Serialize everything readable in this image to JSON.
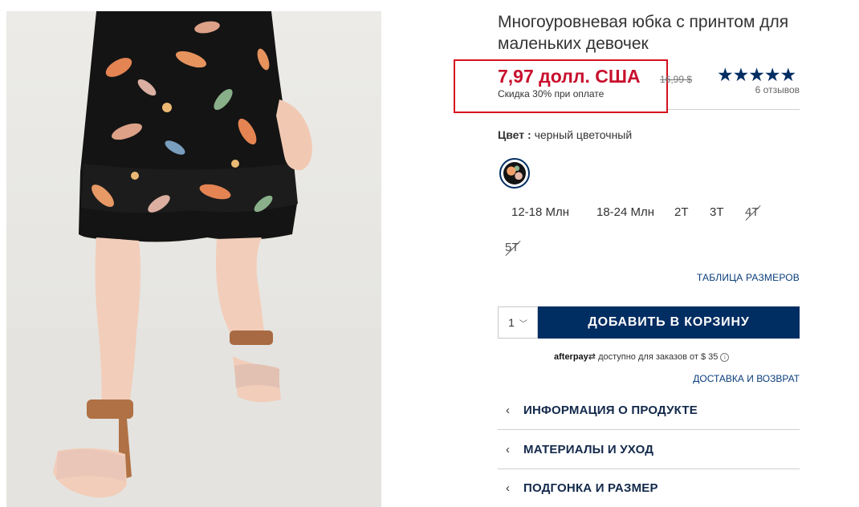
{
  "product": {
    "title": "Многоуровневая юбка с принтом для маленьких девочек",
    "price": "7,97 долл. США",
    "old_price": "16,99 $",
    "discount_note": "Скидка 30% при оплате",
    "rating_stars": "★★★★★",
    "rating_value": 4.5,
    "reviews": "6 отзывов"
  },
  "color": {
    "label": "Цвет :",
    "value": "черный цветочный",
    "swatch_icon": "floral-print-swatch"
  },
  "sizes": [
    {
      "label": "12-18 Млн",
      "available": true
    },
    {
      "label": "18-24 Млн",
      "available": true
    },
    {
      "label": "2T",
      "available": true
    },
    {
      "label": "3T",
      "available": true
    },
    {
      "label": "4T",
      "available": false
    },
    {
      "label": "5T",
      "available": false
    }
  ],
  "size_chart_link": "ТАБЛИЦА РАЗМЕРОВ",
  "cart": {
    "quantity": "1",
    "quantity_icon": "chevron-down-icon",
    "add_button": "ДОБАВИТЬ В КОРЗИНУ"
  },
  "afterpay": {
    "brand": "afterpay",
    "text": "доступно для заказов от $ 35",
    "info_icon": "ⓘ"
  },
  "shipping_link": "ДОСТАВКА И ВОЗВРАТ",
  "accordion": [
    {
      "label": "ИНФОРМАЦИЯ О ПРОДУКТЕ",
      "icon": "chevron-left-icon"
    },
    {
      "label": "МАТЕРИАЛЫ И УХОД",
      "icon": "chevron-left-icon"
    },
    {
      "label": "ПОДГОНКА И РАЗМЕР",
      "icon": "chevron-left-icon"
    }
  ],
  "colors": {
    "accent_navy": "#002d62",
    "sale_red": "#c8102e",
    "highlight_border": "#d6101e"
  }
}
